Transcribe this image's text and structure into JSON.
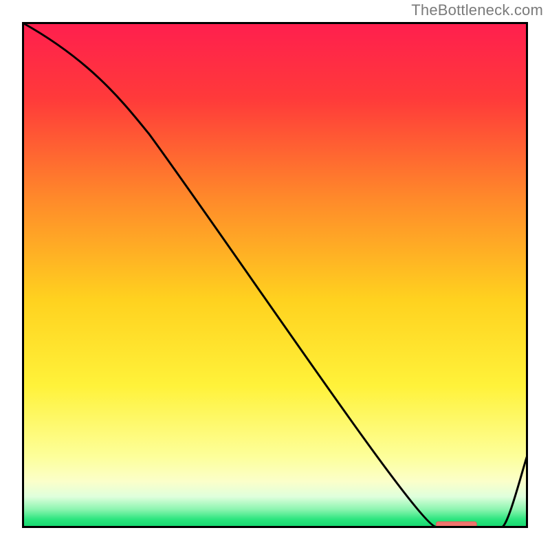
{
  "watermark": "TheBottleneck.com",
  "colors": {
    "frame": "#000000",
    "curve": "#000000",
    "marker_fill": "#f0746e",
    "marker_stroke": "#e45d58",
    "gradient_stops": [
      {
        "offset": 0.0,
        "color": "#ff1f4e"
      },
      {
        "offset": 0.15,
        "color": "#ff3a3a"
      },
      {
        "offset": 0.35,
        "color": "#ff8a2a"
      },
      {
        "offset": 0.55,
        "color": "#ffd21f"
      },
      {
        "offset": 0.72,
        "color": "#fff23a"
      },
      {
        "offset": 0.86,
        "color": "#fdff9a"
      },
      {
        "offset": 0.91,
        "color": "#fbffca"
      },
      {
        "offset": 0.94,
        "color": "#dfffdc"
      },
      {
        "offset": 0.965,
        "color": "#8cf5b0"
      },
      {
        "offset": 0.985,
        "color": "#2be57e"
      },
      {
        "offset": 1.0,
        "color": "#15d86f"
      }
    ]
  },
  "chart_data": {
    "type": "line",
    "title": "",
    "xlabel": "",
    "ylabel": "",
    "xlim": [
      0,
      100
    ],
    "ylim": [
      0,
      100
    ],
    "grid": false,
    "legend": false,
    "x": [
      0,
      25,
      82,
      95,
      100
    ],
    "series": [
      {
        "name": "bottleneck_curve",
        "values": [
          100,
          78,
          0,
          0,
          14
        ]
      }
    ],
    "marker": {
      "x_start": 82,
      "x_end": 90,
      "y": 0.5
    },
    "note": "A single black curve over a vertical red→orange→yellow→green gradient background. Curve starts top-left, bends near x≈25, descends ~linearly to ≈0 around x≈82, flat minimum to ≈x≈95, then rises toward right edge. A small salmon rounded marker sits on the x-axis roughly at x≈82–90."
  }
}
